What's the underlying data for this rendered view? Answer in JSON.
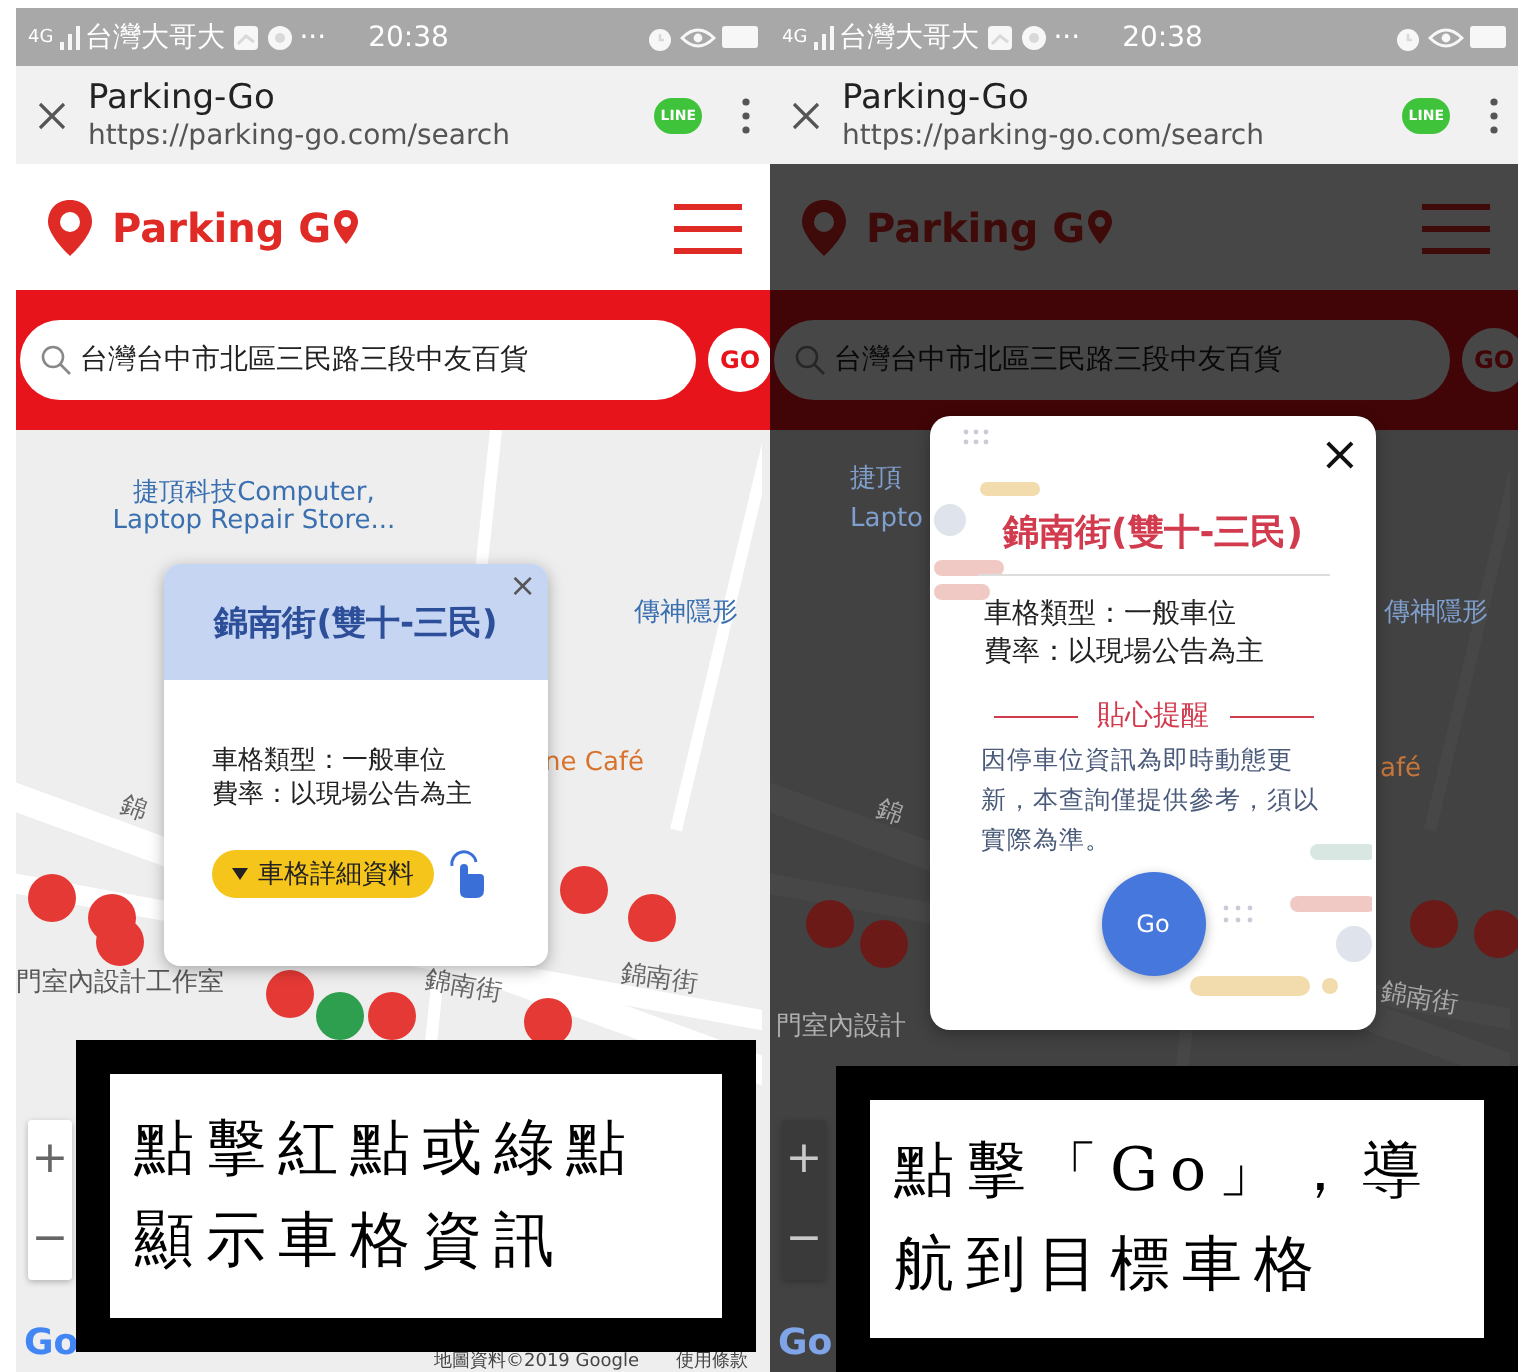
{
  "panels": [
    {
      "status_bar": {
        "network": "4G",
        "carrier": "台灣大哥大",
        "more": "···",
        "time": "20:38"
      },
      "browser": {
        "title": "Parking-Go",
        "url": "https://parking-go.com/search",
        "share_badge": "LINE"
      },
      "app": {
        "logo": "Parking G"
      },
      "search": {
        "value": "台灣台中市北區三民路三段中友百貨",
        "button": "GO"
      },
      "dimmed": false,
      "map": {
        "labels": [
          {
            "text": "捷頂科技Computer, Laptop Repair Store...",
            "kind": "poi"
          },
          {
            "text": "傳神隱形",
            "kind": "poi"
          },
          {
            "text": "ne Café",
            "kind": "cafe"
          },
          {
            "text": "錦",
            "kind": "street"
          },
          {
            "text": "門室內設計工作室",
            "kind": "place"
          },
          {
            "text": "錦南街",
            "kind": "street"
          },
          {
            "text": "錦南街",
            "kind": "street"
          }
        ],
        "dots": [
          {
            "color": "#e53935"
          },
          {
            "color": "#e53935"
          },
          {
            "color": "#e53935"
          },
          {
            "color": "#e53935"
          },
          {
            "color": "#e53935"
          },
          {
            "color": "#e53935"
          },
          {
            "color": "#2e9e4f"
          },
          {
            "color": "#e53935"
          },
          {
            "color": "#e53935"
          }
        ],
        "zoom_in": "+",
        "zoom_out": "−",
        "logo": "Go",
        "attribution": "地圖資料©2019 Google",
        "terms": "使用條款"
      },
      "popup": {
        "kind": "info",
        "close": "×",
        "title": "錦南街(雙十-三民)",
        "lines": [
          "車格類型：一般車位",
          "費率：以現場公告為主"
        ],
        "button": "車格詳細資料"
      },
      "caption": "點擊紅點或綠點顯示車格資訊"
    },
    {
      "status_bar": {
        "network": "4G",
        "carrier": "台灣大哥大",
        "more": "···",
        "time": "20:38"
      },
      "browser": {
        "title": "Parking-Go",
        "url": "https://parking-go.com/search",
        "share_badge": "LINE"
      },
      "app": {
        "logo": "Parking G"
      },
      "search": {
        "value": "台灣台中市北區三民路三段中友百貨",
        "button": "GO"
      },
      "dimmed": true,
      "map": {
        "labels": [
          {
            "text": "捷頂",
            "kind": "poi"
          },
          {
            "text": "Lapto",
            "kind": "poi"
          },
          {
            "text": "傳神隱形",
            "kind": "poi"
          },
          {
            "text": "afé",
            "kind": "cafe"
          },
          {
            "text": "錦",
            "kind": "street"
          },
          {
            "text": "門室內設計",
            "kind": "place"
          },
          {
            "text": "錦南街",
            "kind": "street"
          }
        ],
        "dots": [
          {
            "color": "#6b1a18"
          },
          {
            "color": "#6b1a18"
          },
          {
            "color": "#6b1a18"
          },
          {
            "color": "#6b1a18"
          }
        ],
        "zoom_in": "+",
        "zoom_out": "−",
        "logo": "Go"
      },
      "popup": {
        "kind": "dialog",
        "close": "×",
        "title": "錦南街(雙十-三民)",
        "lines": [
          "車格類型：一般車位",
          "費率：以現場公告為主"
        ],
        "notice_title": "貼心提醒",
        "notice": "因停車位資訊為即時動態更新，本查詢僅提供參考，須以實際為準。",
        "button": "Go"
      },
      "caption": "點擊「Go」，導航到目標車格"
    }
  ]
}
